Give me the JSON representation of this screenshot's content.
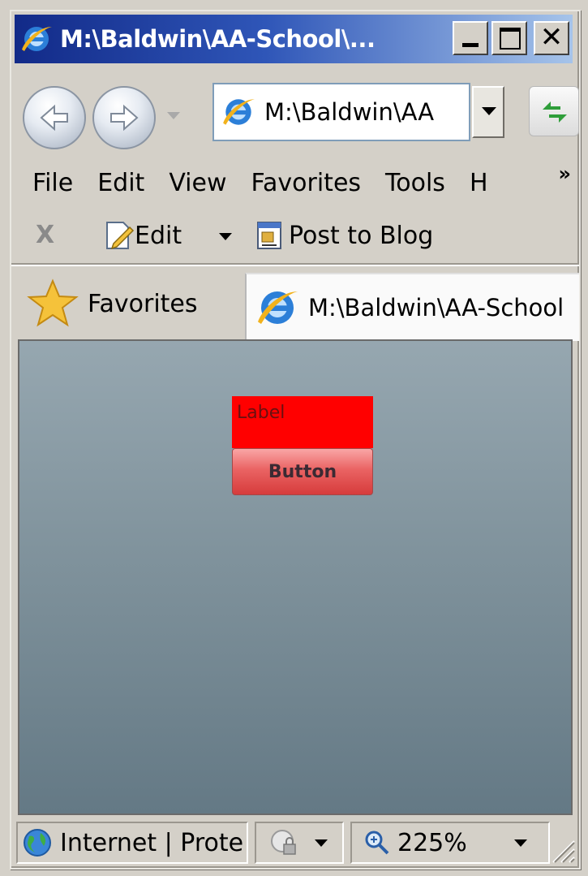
{
  "window": {
    "title": "M:\\Baldwin\\AA-School\\..."
  },
  "navigation": {
    "address": "M:\\Baldwin\\AA"
  },
  "menu": {
    "items": [
      "File",
      "Edit",
      "View",
      "Favorites",
      "Tools",
      "H"
    ],
    "overflow": "»"
  },
  "command_bar": {
    "stop": "X",
    "edit_label": "Edit",
    "blog_label": "Post to Blog"
  },
  "favorites_bar": {
    "favorites_label": "Favorites",
    "tab_title": "M:\\Baldwin\\AA-School"
  },
  "content": {
    "label_text": "Label",
    "button_text": "Button",
    "colors": {
      "label_bg": "#ff0000",
      "button_bg": "#e05050",
      "viewport_bg": "#8a9ca6"
    }
  },
  "status": {
    "zone": "Internet | Prote",
    "zoom": "225%"
  }
}
